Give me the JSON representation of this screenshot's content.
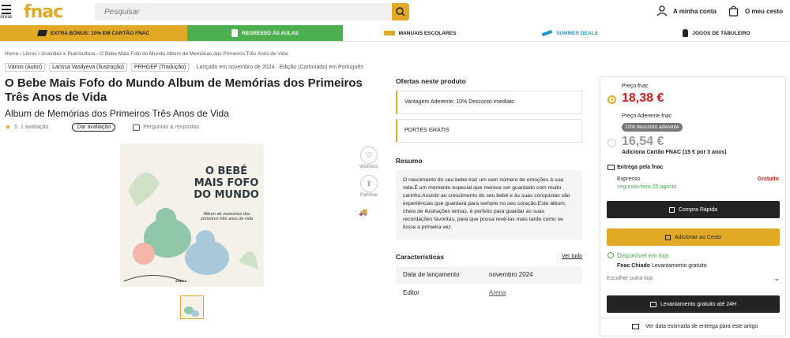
{
  "header": {
    "menu_label": "Áreas",
    "logo": "fnac",
    "search_placeholder": "Pesquisar",
    "account_label": "A minha conta",
    "cart_label": "O meu cesto"
  },
  "promos": [
    {
      "label": "EXTRA BÓNUS: 10% EM CARTÃO FNAC",
      "bg": "#e1a925",
      "color": "#232323"
    },
    {
      "label": "REGRESSO ÀS AULAS",
      "bg": "#4caf50",
      "color": "#ffffff"
    },
    {
      "label": "MANUAIS ESCOLARES",
      "bg": "#ffffff",
      "color": "#232323"
    },
    {
      "label": "SUMMER DEALS",
      "bg": "#ffffff",
      "color": "#2196c9"
    },
    {
      "label": "JOGOS DE TABULEIRO",
      "bg": "#ffffff",
      "color": "#232323"
    }
  ],
  "breadcrumb": [
    "Home",
    "Livros",
    "Gravidez e Puericultura",
    "O Bebe Mais Fofo do Mundo Album de Memórias dos Primeiros Três Anos de Vida"
  ],
  "tags": [
    "Vários (Autor)",
    "Larissa Vasilyeva (Ilustração)",
    "PRHGEP (Tradução)"
  ],
  "meta": [
    "Lançado em novembro de 2024",
    "Edição (Cartonado) em Português"
  ],
  "product": {
    "title": "O Bebe Mais Fofo do Mundo Album de Memórias dos Primeiros Três Anos de Vida",
    "subtitle": "Album de Memórias dos Primeiros Três Anos de Vida",
    "rating_value": "5",
    "rating_count": "1 avaliação",
    "review_button": "Dar avaliação",
    "qa_link": "Perguntas & respostas",
    "wishlist_label": "Wishlists",
    "share_label": "Partilhar",
    "cover_title": "O BEBÉ MAIS FOFO DO MUNDO",
    "cover_sub": "Álbum de memórias dos primeiros três anos de vida",
    "cover_publisher": "ARENA"
  },
  "offers": {
    "heading": "Ofertas neste produto",
    "items": [
      "Vantagem Aderente: 10% Desconto imediato",
      "PORTES GRÁTIS"
    ]
  },
  "summary": {
    "heading": "Resumo",
    "text": "O nascimento do seu bebé traz um sem número de emoções à sua vida.É um momento especial que merece ser guardado com muito carinho.Assistir ao crescimento do seu bebé e às suas conquistas são experiências que guardará para sempre no seu coração.Este álbum, cheio de ilustrações ternas, é perfeito para guardar as suas recordações favoritas, para que possa revê-las mais tarde como se fosse a primeira vez."
  },
  "features": {
    "heading": "Características",
    "see_all": "Ver tudo",
    "rows": [
      {
        "label": "Data de lançamento",
        "value": "novembro 2024"
      },
      {
        "label": "Editor",
        "value": "Arena"
      }
    ]
  },
  "buybox": {
    "price_label": "Preço fnac",
    "price": "18,38 €",
    "member_label": "Preço Aderente fnac",
    "discount_badge": "10% desconto aderente",
    "member_price": "16,54 €",
    "card_note": "Adiciona Cartão FNAC (15 € por 3 anos)",
    "delivery_label": "Entrega pela fnac",
    "express_label": "Expresso",
    "express_date": "segunda-feira 25 agosto",
    "express_price": "Gratuito",
    "quick_buy": "Compra Rápida",
    "add_to_cart": "Adicionar ao Cesto",
    "store_avail": "Disponível em loja",
    "store_name": "Fnac Chiado",
    "store_pickup": "Levantamento gratuito",
    "other_store": "Escolher outra loja",
    "pickup_button": "Levantamento gratuito até 24H",
    "estimate_link": "Ver data estimada de entrega para este artigo",
    "accent": "#e1a925",
    "green": "#4caf50",
    "red": "#d11f1f"
  }
}
